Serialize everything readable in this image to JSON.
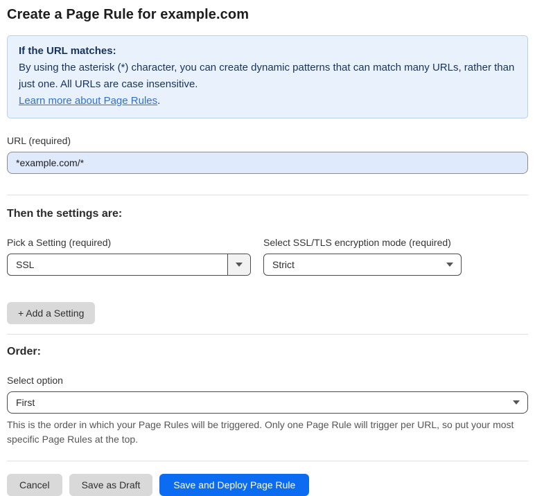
{
  "page": {
    "title": "Create a Page Rule for example.com"
  },
  "info_box": {
    "heading": "If the URL matches:",
    "body": "By using the asterisk (*) character, you can create dynamic patterns that can match many URLs, rather than just one. All URLs are case insensitive.",
    "link_label": "Learn more about Page Rules",
    "link_suffix": "."
  },
  "url_field": {
    "label": "URL (required)",
    "value": "*example.com/*"
  },
  "settings": {
    "heading": "Then the settings are:",
    "pick_setting": {
      "label": "Pick a Setting (required)",
      "value": "SSL"
    },
    "encryption_mode": {
      "label": "Select SSL/TLS encryption mode (required)",
      "value": "Strict"
    },
    "add_button_label": "+ Add a Setting"
  },
  "order": {
    "heading": "Order:",
    "select_label": "Select option",
    "value": "First",
    "help_text": "This is the order in which your Page Rules will be triggered. Only one Page Rule will trigger per URL, so put your most specific Page Rules at the top."
  },
  "footer": {
    "cancel_label": "Cancel",
    "save_draft_label": "Save as Draft",
    "save_deploy_label": "Save and Deploy Page Rule"
  },
  "colors": {
    "accent_blue": "#0b6cf2",
    "info_bg": "#e9f2fc",
    "info_border": "#b3d2ef",
    "info_text": "#16325c",
    "link_blue": "#2f6fd6",
    "input_bg": "#dfeafc"
  }
}
